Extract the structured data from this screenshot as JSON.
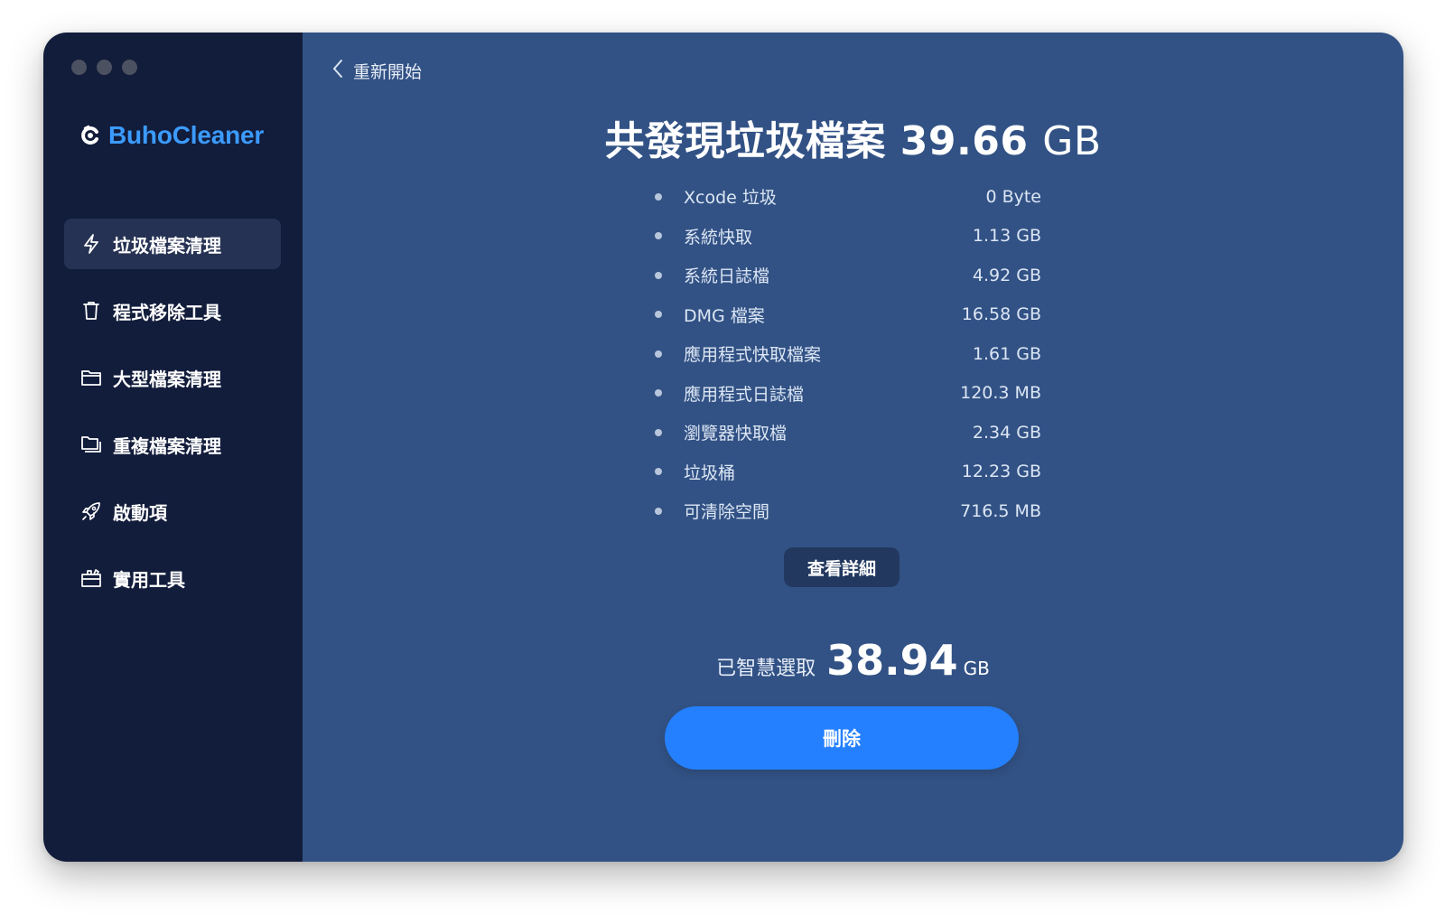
{
  "app": {
    "name": "BuhoCleaner"
  },
  "colors": {
    "sidebar_bg": "#121c3b",
    "main_bg": "#325285",
    "accent": "#2480ff",
    "brand": "#3b9bff"
  },
  "sidebar": {
    "items": [
      {
        "label": "垃圾檔案清理",
        "icon": "lightning-icon",
        "active": true
      },
      {
        "label": "程式移除工具",
        "icon": "trash-icon"
      },
      {
        "label": "大型檔案清理",
        "icon": "folder-icon"
      },
      {
        "label": "重複檔案清理",
        "icon": "duplicate-folder-icon"
      },
      {
        "label": "啟動項",
        "icon": "rocket-icon"
      },
      {
        "label": "實用工具",
        "icon": "toolbox-icon"
      }
    ]
  },
  "header": {
    "back_label": "重新開始"
  },
  "summary": {
    "title_prefix": "共發現垃圾檔案",
    "total_value": "39.66",
    "total_unit": "GB"
  },
  "items": [
    {
      "label": "Xcode 垃圾",
      "size": "0 Byte"
    },
    {
      "label": "系統快取",
      "size": "1.13 GB"
    },
    {
      "label": "系統日誌檔",
      "size": "4.92 GB"
    },
    {
      "label": "DMG 檔案",
      "size": "16.58 GB"
    },
    {
      "label": "應用程式快取檔案",
      "size": "1.61 GB"
    },
    {
      "label": "應用程式日誌檔",
      "size": "120.3 MB"
    },
    {
      "label": "瀏覽器快取檔",
      "size": "2.34 GB"
    },
    {
      "label": "垃圾桶",
      "size": "12.23 GB"
    },
    {
      "label": "可清除空間",
      "size": "716.5 MB"
    }
  ],
  "details_button": "查看詳細",
  "selection": {
    "label": "已智慧選取",
    "value": "38.94",
    "unit": "GB"
  },
  "delete_button": "刪除"
}
